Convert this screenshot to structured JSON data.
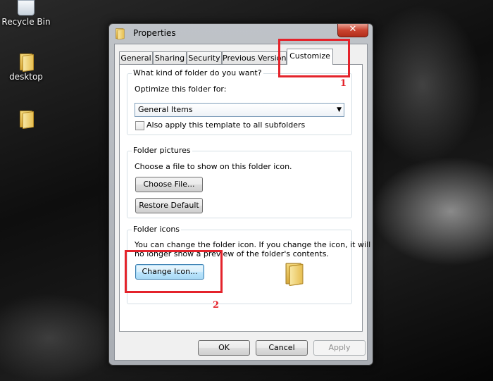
{
  "desktop": {
    "icons": [
      {
        "label": "Recycle Bin",
        "icon": "recycle-bin-icon"
      },
      {
        "label": "desktop",
        "icon": "folder-icon"
      },
      {
        "label": "",
        "icon": "folder-icon"
      }
    ]
  },
  "window": {
    "title": "Properties",
    "close_label": "✕",
    "tabs": [
      {
        "label": "General",
        "active": false
      },
      {
        "label": "Sharing",
        "active": false
      },
      {
        "label": "Security",
        "active": false
      },
      {
        "label": "Previous Versions",
        "active": false
      },
      {
        "label": "Customize",
        "active": true
      }
    ],
    "customize": {
      "folder_type": {
        "group_label": "What kind of folder do you want?",
        "optimize_label": "Optimize this folder for:",
        "selected_value": "General Items",
        "checkbox_label": "Also apply this template to all subfolders",
        "checkbox_checked": false
      },
      "folder_pictures": {
        "group_label": "Folder pictures",
        "description": "Choose a file to show on this folder icon.",
        "choose_file_label": "Choose File...",
        "restore_default_label": "Restore Default"
      },
      "folder_icons": {
        "group_label": "Folder icons",
        "description_line1": "You can change the folder icon. If you change the icon, it will",
        "description_line2": "no longer show a preview of the folder's contents.",
        "change_icon_label": "Change Icon..."
      }
    },
    "footer": {
      "ok_label": "OK",
      "cancel_label": "Cancel",
      "apply_label": "Apply"
    }
  },
  "annotations": [
    {
      "number": "1",
      "color": "#e4232b"
    },
    {
      "number": "2",
      "color": "#e4232b"
    }
  ]
}
